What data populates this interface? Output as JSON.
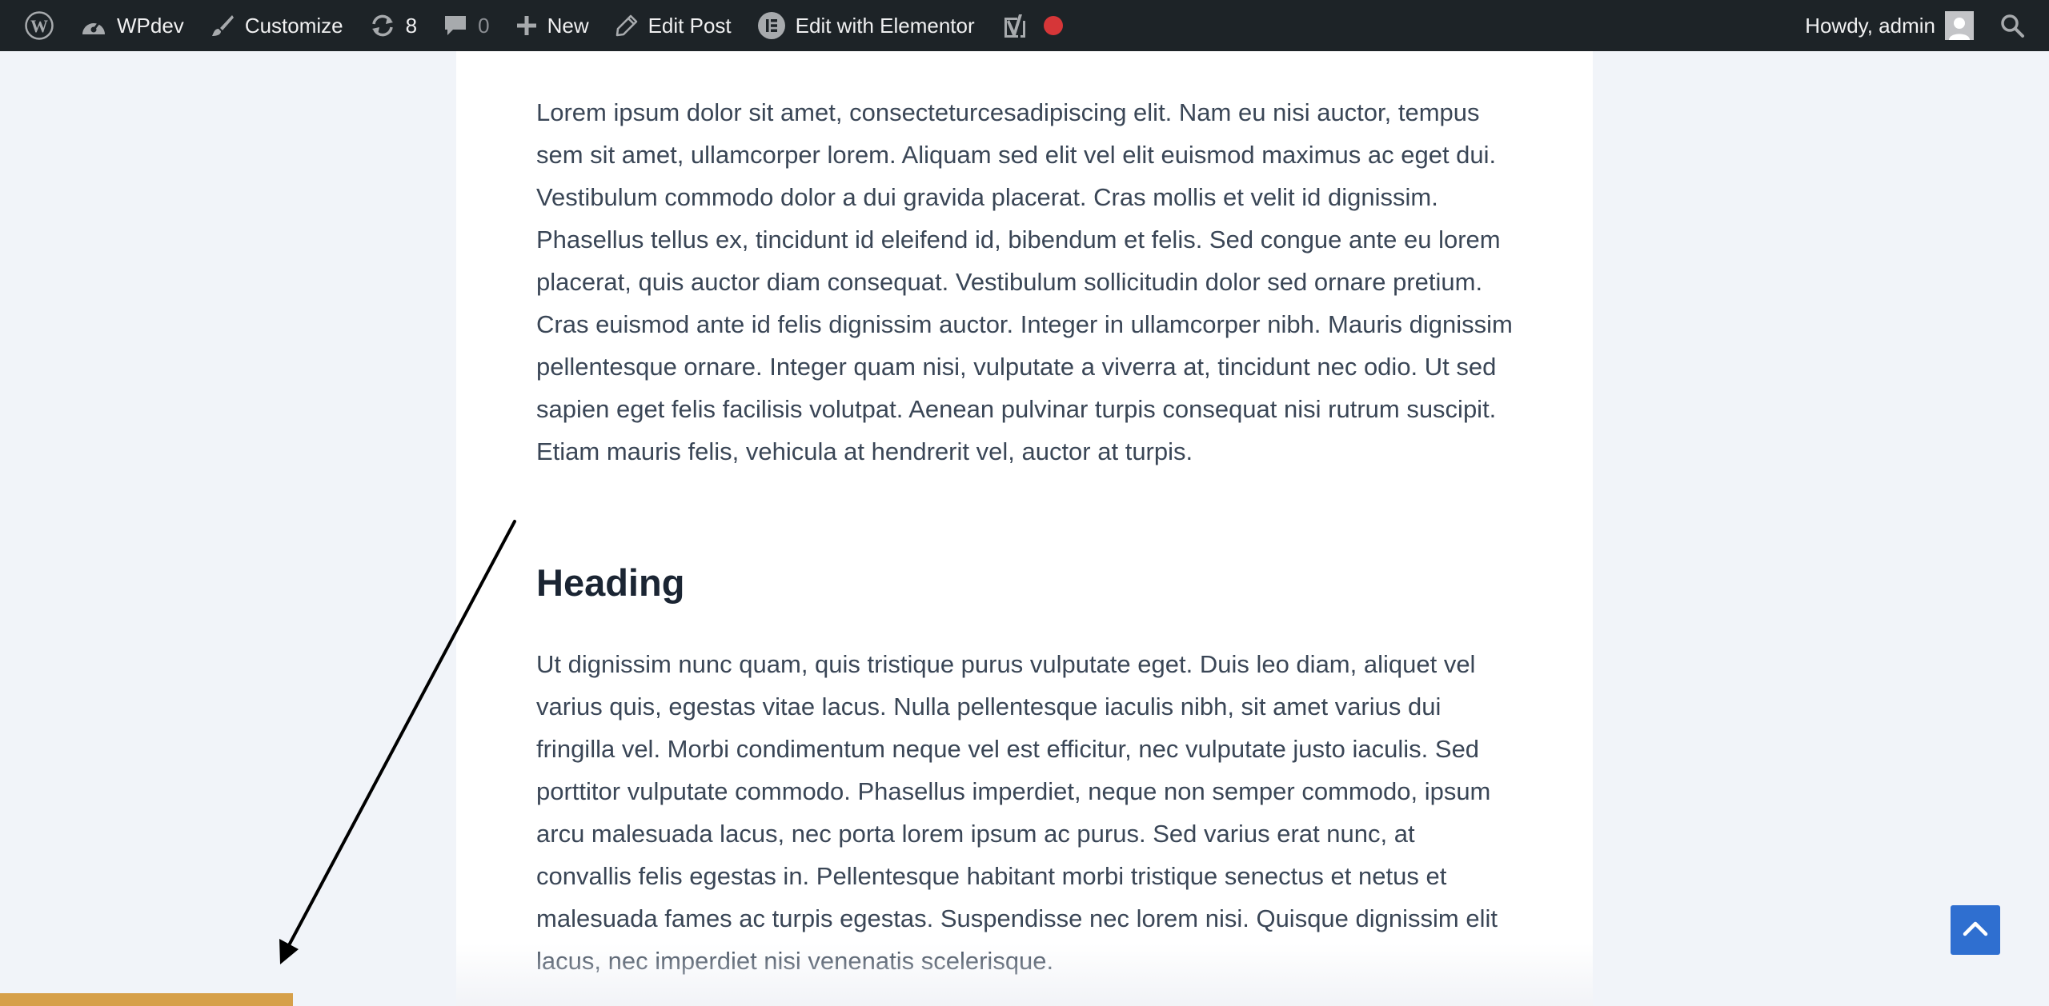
{
  "admin_bar": {
    "site_name": "WPdev",
    "customize": "Customize",
    "updates_count": "8",
    "comments_count": "0",
    "new_label": "New",
    "edit_post": "Edit Post",
    "edit_elementor": "Edit with Elementor",
    "howdy": "Howdy, admin"
  },
  "article": {
    "paragraph_1": "Lorem ipsum dolor sit amet, consecteturcesadipiscing elit. Nam eu nisi auctor, tempus sem sit amet, ullamcorper lorem. Aliquam sed elit vel elit euismod maximus ac eget dui. Vestibulum commodo dolor a dui gravida placerat. Cras mollis et velit id dignissim. Phasellus tellus ex, tincidunt id eleifend id, bibendum et felis. Sed congue ante eu lorem placerat, quis auctor diam consequat. Vestibulum sollicitudin dolor sed ornare pretium. Cras euismod ante id felis dignissim auctor. Integer in ullamcorper nibh. Mauris dignissim pellentesque ornare. Integer quam nisi, vulputate a viverra at, tincidunt nec odio. Ut sed sapien eget felis facilisis volutpat. Aenean pulvinar turpis consequat nisi rutrum suscipit. Etiam mauris felis, vehicula at hendrerit vel, auctor at turpis.",
    "heading": "Heading",
    "paragraph_2": "Ut dignissim nunc quam, quis tristique purus vulputate eget. Duis leo diam, aliquet vel varius quis, egestas vitae lacus. Nulla pellentesque iaculis nibh, sit amet varius dui fringilla vel. Morbi condimentum neque vel est efficitur, nec vulputate justo iaculis. Sed porttitor vulputate commodo. Phasellus imperdiet, neque non semper commodo, ipsum arcu malesuada lacus, nec porta lorem ipsum ac purus. Sed varius erat nunc, at convallis felis egestas in. Pellentesque habitant morbi tristique senectus et netus et malesuada fames ac turpis egestas. Suspendisse nec lorem nisi. Quisque dignissim elit lacus, nec imperdiet nisi venenatis scelerisque."
  },
  "reading_progress": {
    "percent": 14.3,
    "color": "#d6a04a"
  },
  "colors": {
    "admin_bar_bg": "#1d2327",
    "recording_dot": "#d63638",
    "scroll_top_button": "#2f6fd0",
    "page_bg": "#f1f4f9"
  },
  "icons": {
    "wordpress": "wordpress-logo-icon",
    "dashboard": "dashboard-gauge-icon",
    "customize": "paintbrush-icon",
    "updates": "refresh-icon",
    "comments": "comment-bubble-icon",
    "new": "plus-icon",
    "edit": "pencil-icon",
    "elementor": "elementor-icon",
    "yoast": "yoast-icon",
    "search": "search-icon",
    "scroll_top": "chevron-up-icon"
  }
}
